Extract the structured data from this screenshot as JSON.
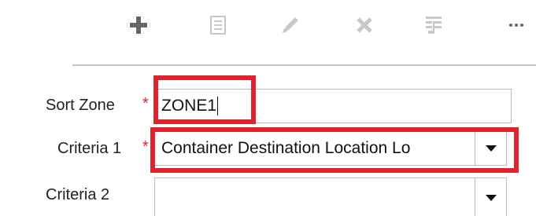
{
  "toolbar": {
    "buttons": [
      {
        "name": "add",
        "icon": "plus-icon"
      },
      {
        "name": "copy",
        "icon": "document-icon"
      },
      {
        "name": "edit",
        "icon": "pencil-icon"
      },
      {
        "name": "delete",
        "icon": "close-icon"
      },
      {
        "name": "configure",
        "icon": "table-grid-icon"
      },
      {
        "name": "more",
        "icon": "more-icon"
      }
    ]
  },
  "form": {
    "sort_zone": {
      "label": "Sort Zone",
      "required_mark": "*",
      "value": "ZONE1"
    },
    "criteria1": {
      "label": "Criteria 1",
      "required_mark": "*",
      "value": "Container Destination Location Lo"
    },
    "criteria2": {
      "label": "Criteria 2",
      "value": ""
    }
  },
  "colors": {
    "highlight": "#e0242f",
    "required": "#d12b2b",
    "icon_active": "#666666",
    "icon_disabled": "#c8c8c8"
  }
}
